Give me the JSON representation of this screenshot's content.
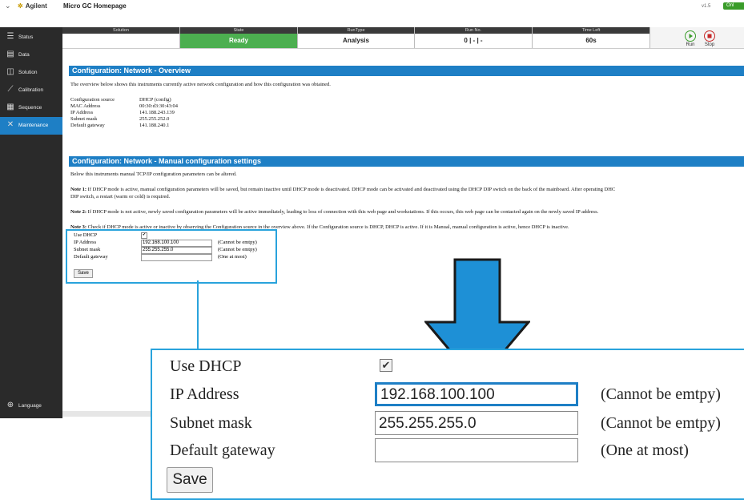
{
  "topbar": {
    "brand": "Agilent",
    "title": "Micro GC Homepage",
    "version": "v1.5",
    "online": "Onl"
  },
  "sidebar": {
    "items": [
      {
        "label": "Status",
        "icon": "list-icon"
      },
      {
        "label": "Data",
        "icon": "data-icon"
      },
      {
        "label": "Solution",
        "icon": "solution-icon"
      },
      {
        "label": "Calibration",
        "icon": "calibration-icon"
      },
      {
        "label": "Sequence",
        "icon": "sequence-icon"
      },
      {
        "label": "Maintenance",
        "icon": "wrench-icon"
      }
    ],
    "language": "Language",
    "active": "Maintenance"
  },
  "status": {
    "headers": [
      "Solution",
      "State",
      "RunType",
      "Run No.",
      "Time Left"
    ],
    "values": [
      "",
      "Ready",
      "Analysis",
      "0 | - | -",
      "60s"
    ],
    "run_label": "Run",
    "stop_label": "Stop",
    "ready_color": "#4caf50"
  },
  "overview": {
    "heading": "Configuration: Network - Overview",
    "intro": "The overview below shows this instruments currently active network configuration and how this configuration was obtained.",
    "rows": [
      {
        "k": "Configuration source",
        "v": "DHCP (config)"
      },
      {
        "k": "MAC Address",
        "v": "00:30:d3:30:43:04"
      },
      {
        "k": "IP Address",
        "v": "141.188.243.139"
      },
      {
        "k": "Subnet mask",
        "v": "255.255.252.0"
      },
      {
        "k": "Default gateway",
        "v": "141.188.240.1"
      }
    ]
  },
  "manual": {
    "heading": "Configuration: Network - Manual configuration settings",
    "intro": "Below this instruments manual TCP/IP configuration parameters can be altered.",
    "note1_label": "Note 1:",
    "note1": " If DHCP mode is active, manual configuration parameters will be saved, but remain inactive until DHCP mode is deactivated. DHCP mode can be activated and deactivated using the DHCP DIP switch on the back of the mainboard. After operating DHC",
    "note1_cont": "DIP switch, a restart (warm or cold) is required.",
    "note2_label": "Note 2:",
    "note2": " If DHCP mode is not active, newly saved configuration parameters will be active immediately, leading to loss of connection with this web page and workstations. If this occurs, this web page can be contacted again on the newly saved IP address.",
    "note3_label": "Note 3:",
    "note3": " Check if DHCP mode is active or inactive by observing the Configuration source in the overview above. If the Configuration source is DHCP, DHCP is active. If it is Manual, manual configuration is active, hence DHCP is inactive."
  },
  "form": {
    "use_dhcp_label": "Use DHCP",
    "use_dhcp_checked": "✔",
    "ip_label": "IP Address",
    "ip_value": "192.168.100.100",
    "ip_note": "(Cannot be emtpy)",
    "subnet_label": "Subnet mask",
    "subnet_value": "255.255.255.0",
    "subnet_note": "(Cannot be emtpy)",
    "gateway_label": "Default gateway",
    "gateway_value": "",
    "gateway_note": "(One at most)",
    "save_label": "Save"
  },
  "accent_color": "#1e7fc5",
  "callout_color": "#29a3dc"
}
